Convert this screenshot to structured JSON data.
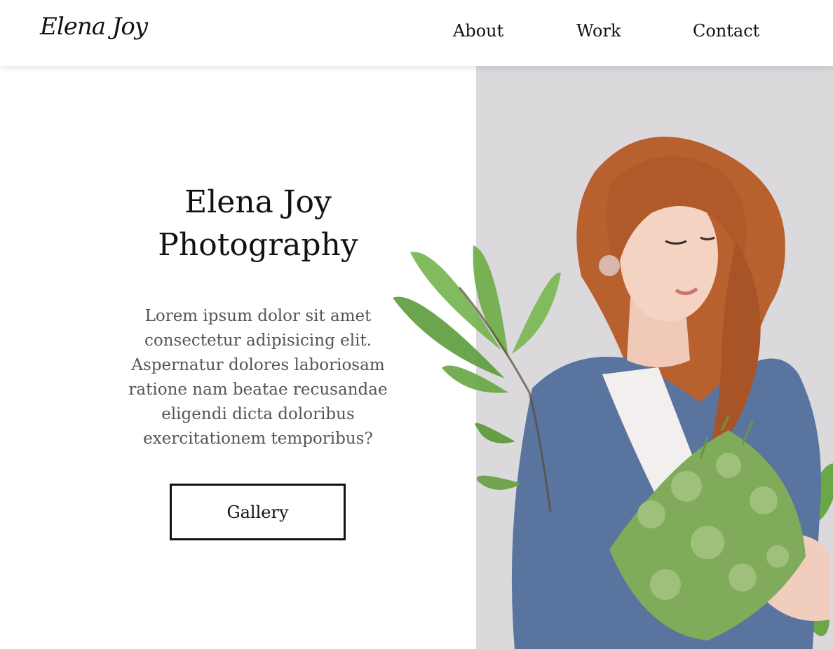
{
  "header": {
    "logo": "Elena Joy",
    "nav": {
      "about": "About",
      "work": "Work",
      "contact": "Contact"
    }
  },
  "hero": {
    "title_line1": "Elena Joy",
    "title_line2": "Photography",
    "description_lines": [
      "Lorem ipsum dolor sit amet",
      "consectetur adipisicing elit.",
      "Aspernatur dolores laboriosam",
      "ratione nam beatae recusandae",
      "eligendi dicta doloribus",
      "exercitationem temporibus?"
    ],
    "button_label": "Gallery"
  },
  "colors": {
    "text": "#111111",
    "muted_text": "#555555",
    "photo_background": "#dcd9dd",
    "hair": "#b8612e",
    "sweater": "#58749f",
    "leaf": "#6da948"
  },
  "icons": {
    "photo": "woman-with-green-flowers-photo",
    "leaves": "green-leaves-decoration"
  }
}
